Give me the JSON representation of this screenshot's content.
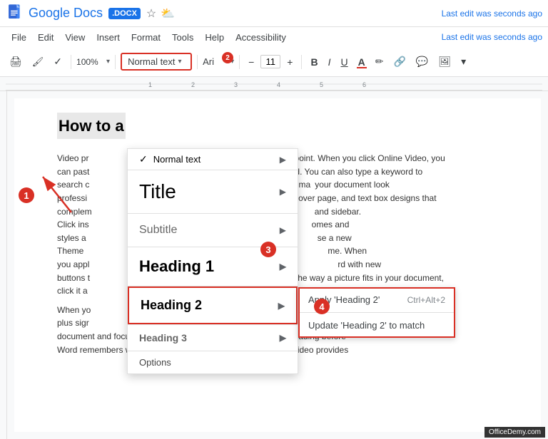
{
  "app": {
    "title": "Google Docs",
    "badge": ".DOCX",
    "last_edit": "Last edit was seconds ago"
  },
  "menubar": {
    "items": [
      "File",
      "Edit",
      "View",
      "Insert",
      "Format",
      "Tools",
      "Help",
      "Accessibility"
    ]
  },
  "toolbar": {
    "zoom": "100%",
    "style": "Normal text",
    "font": "Ari",
    "font_size": "11",
    "bold": "B",
    "italic": "I",
    "underline": "U",
    "underline_color": "A"
  },
  "dropdown": {
    "normal_text": "Normal text",
    "title": "Title",
    "subtitle": "Subtitle",
    "heading1": "Heading 1",
    "heading2": "Heading 2",
    "heading3": "Heading 3",
    "options": "Options"
  },
  "submenu": {
    "apply": "Apply 'Heading 2'",
    "shortcut": "Ctrl+Alt+2",
    "update": "Update 'Heading 2' to match"
  },
  "document": {
    "heading": "How to a",
    "para1": "Video pr                                              prove your point. When you click Online Video, you",
    "para1b": "can past                                           you want to add. You can also type a keyword to",
    "para1c": "search c                                          ur document. To ma   your document look",
    "para1d": "professi                                           header, footer, cover page, and text box designs that",
    "para1e": "complem                                          and sidebar.",
    "para1f": "Click ins                                          omes and",
    "para1g": "styles a                                           se a new",
    "para1h": "Theme                                           me. When",
    "para1i": "you appl                                        rd with new",
    "para1j": "buttons t                                     n. To change the way a picture fits in your document,",
    "para1k": "click it a                                    ears next to it.",
    "para2": "When yo                                          want to add a row or a column, and then click the",
    "para2b": "plus sigr                                        w Reading view. You can collapse parts of the",
    "para2c": "document and focus on the text you want. If you need to stop reading before",
    "para2d": "Word remembers where you left off - even on another device. Video provides"
  },
  "annotations": {
    "step1": "1",
    "step2": "2",
    "step3": "3",
    "step4": "4"
  },
  "watermark": "OfficeDemy.com"
}
